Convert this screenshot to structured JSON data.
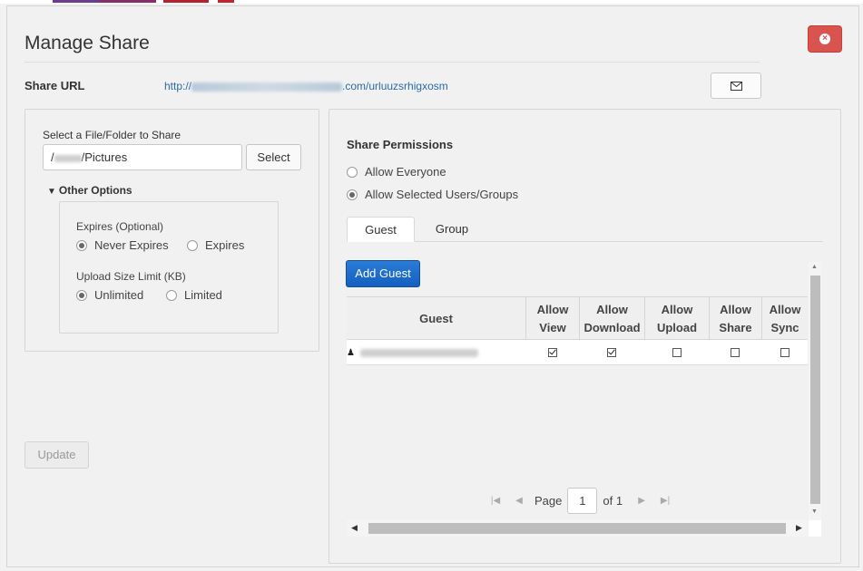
{
  "dialog": {
    "title": "Manage Share",
    "share_url_label": "Share URL",
    "share_url_prefix": "http://",
    "share_url_suffix": ".com/urluuzsrhigxosm"
  },
  "file_select": {
    "label": "Select a File/Folder to Share",
    "path_prefix": "/",
    "path_suffix": "/Pictures",
    "select_button": "Select"
  },
  "other_options": {
    "toggle_label": "Other Options",
    "expires_label": "Expires (Optional)",
    "expires_options": [
      "Never Expires",
      "Expires"
    ],
    "expires_selected": "Never Expires",
    "upload_limit_label": "Upload Size Limit (KB)",
    "upload_limit_options": [
      "Unlimited",
      "Limited"
    ],
    "upload_limit_selected": "Unlimited"
  },
  "update_button": "Update",
  "permissions": {
    "title": "Share Permissions",
    "options": [
      "Allow Everyone",
      "Allow Selected Users/Groups"
    ],
    "selected": "Allow Selected Users/Groups"
  },
  "tabs": [
    "Guest",
    "Group"
  ],
  "active_tab": "Guest",
  "add_guest_button": "Add Guest",
  "grid": {
    "columns": [
      {
        "line1": "Guest",
        "line2": ""
      },
      {
        "line1": "Allow",
        "line2": "View"
      },
      {
        "line1": "Allow",
        "line2": "Download"
      },
      {
        "line1": "Allow",
        "line2": "Upload"
      },
      {
        "line1": "Allow",
        "line2": "Share"
      },
      {
        "line1": "Allow",
        "line2": "Sync"
      }
    ],
    "rows": [
      {
        "guest": "",
        "view": true,
        "download": true,
        "upload": false,
        "share": false,
        "sync": false
      }
    ]
  },
  "pager": {
    "page_label": "Page",
    "current_page": "1",
    "of_label": "of 1"
  },
  "icons": {
    "close": "close-circle-icon",
    "mail": "envelope-icon",
    "person": "user-icon",
    "pager_first": "first-page-icon",
    "pager_prev": "prev-page-icon",
    "pager_next": "next-page-icon",
    "pager_last": "last-page-icon"
  },
  "colors": {
    "close_button": "#d9534f",
    "add_guest_button": "#1a6bd0",
    "link": "#2a6aa8"
  }
}
